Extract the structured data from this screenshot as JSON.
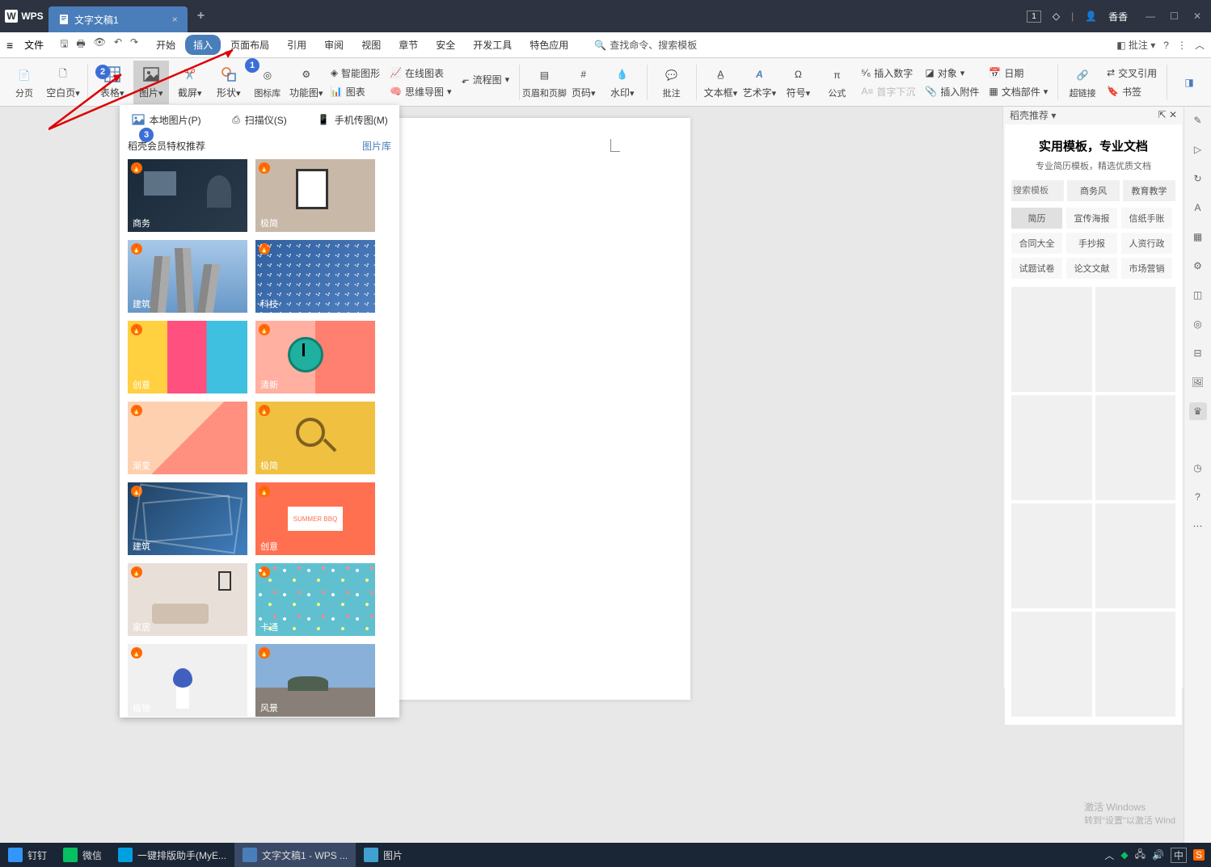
{
  "titlebar": {
    "app": "WPS",
    "doc_tab": "文字文稿1",
    "badge": "1",
    "user": "香香"
  },
  "menubar": {
    "file": "文件",
    "tabs": [
      "开始",
      "插入",
      "页面布局",
      "引用",
      "审阅",
      "视图",
      "章节",
      "安全",
      "开发工具",
      "特色应用"
    ],
    "search": "查找命令、搜索模板",
    "comment_btn": "批注"
  },
  "ribbon": {
    "buttons": {
      "page_break": "分页",
      "blank_page": "空白页",
      "table": "表格",
      "picture": "图片",
      "screenshot": "截屏",
      "shape": "形状",
      "icon_lib": "图标库",
      "function": "功能图",
      "smart_graphic": "智能图形",
      "online_chart": "在线图表",
      "flow_chart": "流程图",
      "chart": "图表",
      "mind_map": "思维导图",
      "header_footer": "页眉和页脚",
      "page_number": "页码",
      "watermark": "水印",
      "annotate": "批注",
      "text_box": "文本框",
      "art_text": "艺术字",
      "symbol": "符号",
      "formula": "公式",
      "insert_number": "插入数字",
      "drop_cap": "首字下沉",
      "object": "对象",
      "attachment": "插入附件",
      "date": "日期",
      "doc_parts": "文档部件",
      "hyperlink": "超链接",
      "cross_ref": "交叉引用",
      "bookmark": "书签"
    }
  },
  "image_dropdown": {
    "local_picture": "本地图片(P)",
    "scanner": "扫描仪(S)",
    "phone_transfer": "手机传图(M)",
    "recommend_title": "稻壳会员特权推荐",
    "image_lib": "图片库",
    "thumbs": [
      {
        "label": "商务",
        "bg": "linear-gradient(135deg,#1a2a3a,#2a3a4a)",
        "extra": "office"
      },
      {
        "label": "极简",
        "bg": "#c8b8a8",
        "extra": "frame"
      },
      {
        "label": "建筑",
        "bg": "linear-gradient(180deg,#a8c8e8,#6898c8)",
        "extra": "building"
      },
      {
        "label": "科技",
        "bg": "linear-gradient(135deg,#3060a0,#5080c0)",
        "extra": "tech"
      },
      {
        "label": "创意",
        "bg": "linear-gradient(90deg,#ffd040 33%,#ff5080 33% 66%,#40c0e0 66%)",
        "extra": ""
      },
      {
        "label": "清新",
        "bg": "linear-gradient(90deg,#ffb0a0 50%,#ff8070 50%)",
        "extra": "clock"
      },
      {
        "label": "渐变",
        "bg": "linear-gradient(135deg,#ffd0b0 50%,#ff9080 50%)",
        "extra": ""
      },
      {
        "label": "极简",
        "bg": "#f0c040",
        "extra": "magnifier"
      },
      {
        "label": "建筑",
        "bg": "linear-gradient(135deg,#204060,#4080c0)",
        "extra": "building2"
      },
      {
        "label": "创意",
        "bg": "#ff7050",
        "extra": "bbq"
      },
      {
        "label": "家居",
        "bg": "#e8e0d8",
        "extra": "sofa"
      },
      {
        "label": "卡通",
        "bg": "#60c0d0",
        "extra": "pattern"
      },
      {
        "label": "植物",
        "bg": "#f0f0f0",
        "extra": "plant"
      },
      {
        "label": "风景",
        "bg": "linear-gradient(180deg,#88b0d8 60%,#888078 60%)",
        "extra": "landscape"
      }
    ]
  },
  "right_panel": {
    "header": "稻壳推荐",
    "title": "实用模板，专业文档",
    "subtitle": "专业简历模板，精选优质文档",
    "search_placeholder": "搜索模板",
    "tabs": [
      "商务风",
      "教育教学"
    ],
    "tags": [
      "简历",
      "宣传海报",
      "信纸手账",
      "合同大全",
      "手抄报",
      "人资行政",
      "试题试卷",
      "论文文献",
      "市场营销"
    ]
  },
  "watermark": {
    "line1": "激活 Windows",
    "line2": "转到\"设置\"以激活 Wind"
  },
  "taskbar": {
    "items": [
      "钉钉",
      "微信",
      "一键排版助手(MyE...",
      "文字文稿1 - WPS ...",
      "图片"
    ],
    "ime": "中"
  },
  "annotations": {
    "c1": "1",
    "c2": "2",
    "c3": "3"
  }
}
